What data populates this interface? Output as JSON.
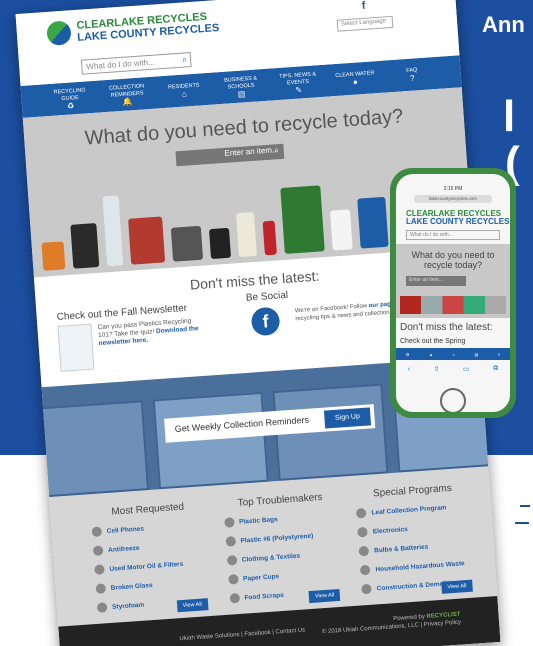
{
  "right_header": "Ann",
  "right_big_1": "l",
  "right_big_2": "(",
  "site": {
    "logo": {
      "line1": "CLEARLAKE RECYCLES",
      "line2": "LAKE COUNTY RECYCLES"
    },
    "search_placeholder": "What do I do with...",
    "facebook_glyph": "f",
    "language_select": "Select Language",
    "nav": [
      {
        "label": "RECYCLING GUIDE",
        "icon": "recycle-icon",
        "glyph": "♻"
      },
      {
        "label": "COLLECTION REMINDERS",
        "icon": "bell-icon",
        "glyph": "🔔"
      },
      {
        "label": "RESIDENTS",
        "icon": "home-icon",
        "glyph": "⌂"
      },
      {
        "label": "BUSINESS & SCHOOLS",
        "icon": "building-icon",
        "glyph": "▤"
      },
      {
        "label": "TIPS, NEWS & EVENTS",
        "icon": "lightbulb-icon",
        "glyph": "✎"
      },
      {
        "label": "CLEAN WATER",
        "icon": "water-drop-icon",
        "glyph": "●"
      },
      {
        "label": "FAQ",
        "icon": "question-icon",
        "glyph": "?"
      }
    ],
    "hero_title": "What do you need to recycle today?",
    "hero_input_placeholder": "Enter an item...",
    "latest_title": "Don't miss the latest:",
    "newsletter": {
      "title": "Check out the Fall Newsletter",
      "text": "Can you pass Plastics Recycling 101? Take the quiz!",
      "link": "Download the newsletter here."
    },
    "social": {
      "title": "Be Social",
      "text_a": "We're on Facebook! Follow ",
      "link": "our page",
      "text_b": " for recycling tips & news and collection information."
    },
    "cta": {
      "text": "Get Weekly Collection Reminders",
      "button": "Sign Up"
    },
    "most_requested": {
      "title": "Most Requested",
      "items": [
        "Cell Phones",
        "Antifreeze",
        "Used Motor Oil & Filters",
        "Broken Glass",
        "Styrofoam"
      ],
      "view_all": "View All"
    },
    "troublemakers": {
      "title": "Top Troublemakers",
      "items": [
        "Plastic Bags",
        "Plastic #6 (Polystyrene)",
        "Clothing & Textiles",
        "Paper Cups",
        "Food Scraps"
      ],
      "view_all": "View All"
    },
    "special": {
      "title": "Special Programs",
      "items": [
        "Leaf Collection Program",
        "Electronics",
        "Bulbs & Batteries",
        "Household Hazardous Waste",
        "Construction & Demolition"
      ],
      "view_all": "View All"
    },
    "footer_left": "Ukiah Waste Solutions | Facebook | Contact Us",
    "footer_powered": "Powered by",
    "footer_brand": "RECYCLIST",
    "footer_copy": "© 2018 Ukiah Communications, LLC | Privacy Policy"
  },
  "phone": {
    "time": "2:16 PM",
    "url": "lakecountyrecycles.com",
    "logo": {
      "line1": "CLEARLAKE RECYCLES",
      "line2": "LAKE COUNTY RECYCLES"
    },
    "search_placeholder": "What do I do with...",
    "hero_title": "What do you need to recycle today?",
    "hero_input": "Enter an item...",
    "latest": "Don't miss the latest:",
    "spring": "Check out the Spring"
  }
}
